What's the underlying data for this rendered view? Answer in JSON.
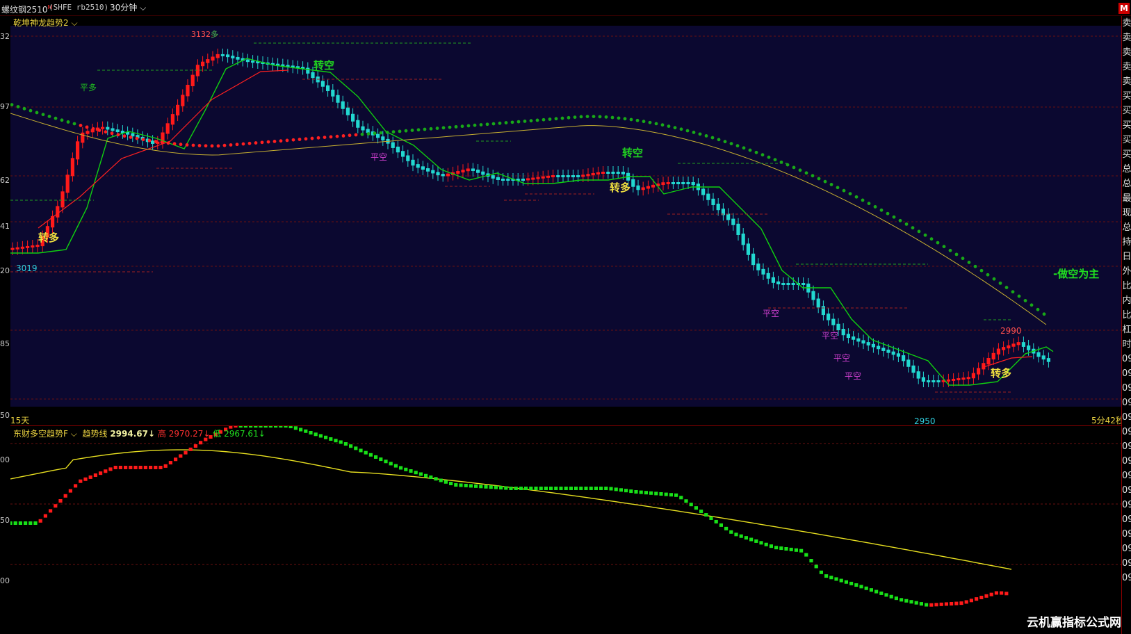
{
  "header": {
    "symbol": "螺纹钢2510",
    "badge": "M",
    "code": "(SHFE rb2510)",
    "period": "30分钟",
    "period_arrow": "chevron-down-icon",
    "corner_badge": "M"
  },
  "main_chart": {
    "indicator_name": "乾坤神龙趋势2",
    "indicator_arrow": "chevron-down-icon",
    "left_ticks": [
      "32",
      "97",
      "62",
      "41",
      "20",
      "85",
      "50"
    ],
    "range_label": "15天",
    "countdown": "5分42秒",
    "high_label": "3132",
    "high_label_suffix": "多",
    "low_label": "3019",
    "low_label_2": "2950",
    "recent_high": "2990",
    "signals": {
      "pingduo": "平多",
      "zhuanduo_1": "转多",
      "zhuankong_1": "转空",
      "pingkong_1": "平空",
      "zhuankong_2": "转空",
      "zhuanduo_2": "转多",
      "pingkong_2": "平空",
      "pingkong_3": "平空",
      "pingkong_4": "平空",
      "pingkong_5": "平空",
      "zhuanduo_3": "转多",
      "zuokong": "-做空为主"
    },
    "colors": {
      "background": "#0b0830",
      "bull_candle": "#ff1a1a",
      "bear_candle": "#22d8d0",
      "dotted_bull": "#ff2020",
      "dotted_bear": "#18a818",
      "ma_green": "#10d010",
      "ma_red": "#ff2020",
      "ma_yellow": "#c8b030"
    }
  },
  "sub_chart": {
    "indicator_name": "东财多空趋势F",
    "indicator_arrow": "chevron-down-icon",
    "trend_label": "趋势线",
    "trend_value": "2994.67↓",
    "high_label": "高",
    "high_value": "2970.27↓",
    "low_label": "低",
    "low_value": "2967.61↓",
    "left_ticks": [
      "00",
      "50",
      "00"
    ],
    "colors": {
      "trend": "#e8e020",
      "up": "#ff1a1a",
      "down": "#18e018"
    }
  },
  "right_panel": {
    "items": [
      "卖",
      "卖",
      "卖",
      "卖",
      "卖",
      "买",
      "买",
      "买",
      "买",
      "买",
      "总",
      "总",
      "最",
      "现",
      "总",
      "持",
      "日",
      "外",
      "比",
      "内",
      "比",
      "杠",
      "时",
      "09",
      "09",
      "09",
      "09",
      "09",
      "09",
      "09",
      "09",
      "09",
      "09",
      "09",
      "09",
      "09",
      "09",
      "09",
      "09"
    ]
  },
  "watermark": "云机赢指标公式网"
}
